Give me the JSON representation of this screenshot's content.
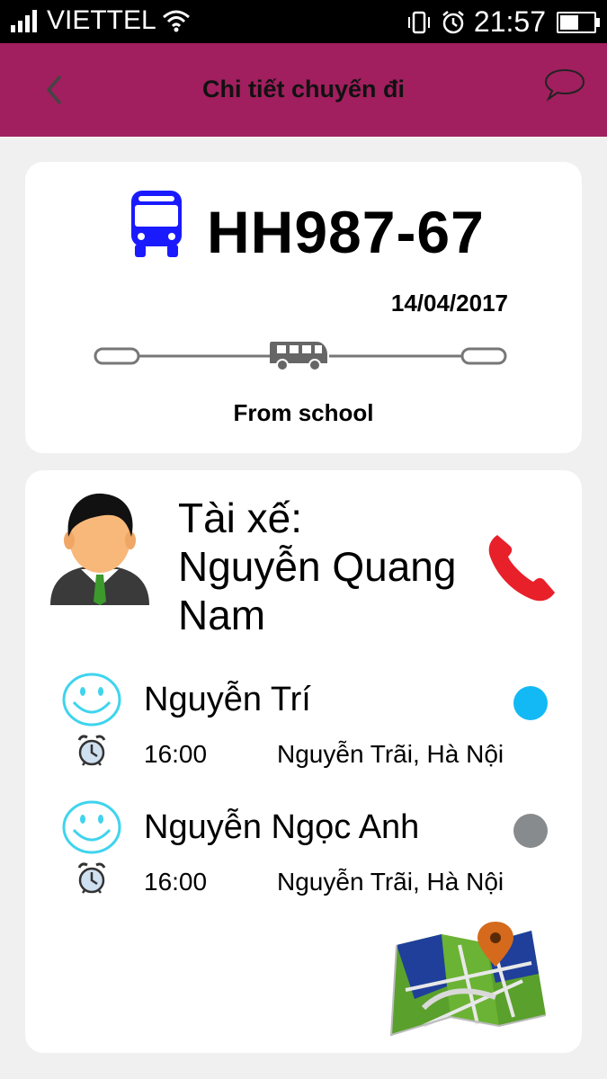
{
  "status_bar": {
    "carrier": "VIETTEL",
    "time": "21:57",
    "icons": [
      "signal-icon",
      "wifi-icon",
      "vibrate-icon",
      "alarm-icon",
      "battery-icon"
    ],
    "battery_level": 0.55
  },
  "header": {
    "title": "Chi tiết chuyến đi",
    "background": "#a11f5e",
    "back_icon": "chevron-left-icon",
    "chat_icon": "chat-bubble-icon"
  },
  "trip": {
    "plate": "HH987-67",
    "date": "14/04/2017",
    "direction": "From school",
    "bus_icon_color": "#1a1aff"
  },
  "driver": {
    "label": "Tài xế:",
    "name": "Nguyễn Quang Nam",
    "call_icon_color": "#e8202a"
  },
  "students": [
    {
      "name": "Nguyễn Trí",
      "time": "16:00",
      "address": "Nguyễn Trãi, Hà Nội",
      "status_color": "#12b9f5"
    },
    {
      "name": "Nguyễn Ngọc Anh",
      "time": "16:00",
      "address": "Nguyễn Trãi, Hà Nội",
      "status_color": "#888b8d"
    }
  ],
  "map_button": {
    "icon": "map-pin-icon"
  }
}
